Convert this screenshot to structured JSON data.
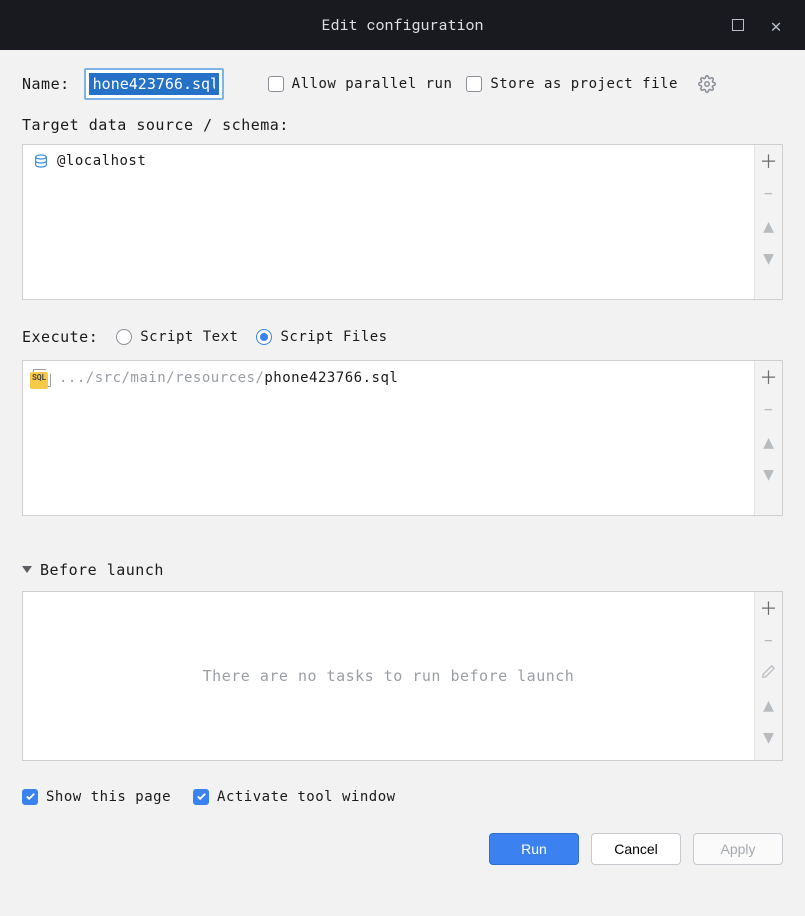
{
  "window": {
    "title": "Edit configuration"
  },
  "form": {
    "name_label": "Name:",
    "name_value": "hone423766.sql",
    "allow_parallel": {
      "label": "Allow parallel run",
      "checked": false
    },
    "store_project_file": {
      "label": "Store as project file",
      "checked": false
    },
    "target_label": "Target data source / schema:",
    "datasource": {
      "name": "@localhost"
    },
    "execute_label": "Execute:",
    "execute_options": {
      "script_text": {
        "label": "Script Text",
        "selected": false
      },
      "script_files": {
        "label": "Script Files",
        "selected": true
      }
    },
    "script_file": {
      "path_prefix": ".../src/main/resources/",
      "filename": "phone423766.sql"
    }
  },
  "before_launch": {
    "title": "Before launch",
    "empty_msg": "There are no tasks to run before launch"
  },
  "bottom_checks": {
    "show_page": {
      "label": "Show this page",
      "checked": true
    },
    "activate_tool_window": {
      "label": "Activate tool window",
      "checked": true
    }
  },
  "buttons": {
    "run": "Run",
    "cancel": "Cancel",
    "apply": "Apply"
  }
}
